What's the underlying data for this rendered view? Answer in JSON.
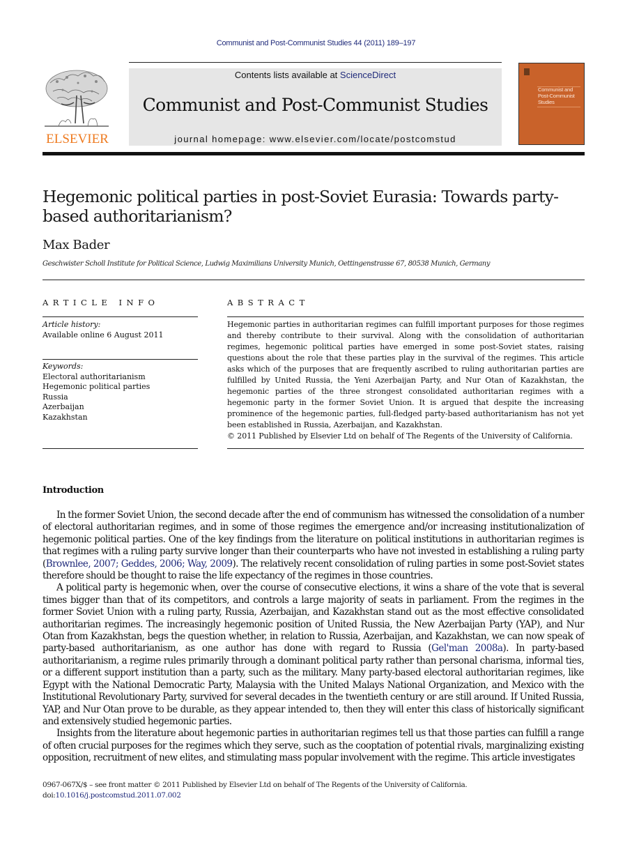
{
  "header": {
    "citation": "Communist and Post-Communist Studies 44 (2011) 189–197",
    "contents_prefix": "Contents lists available at ",
    "contents_link": "ScienceDirect",
    "journal_title": "Communist and Post-Communist Studies",
    "homepage_prefix": "journal homepage: ",
    "homepage_url": "www.elsevier.com/locate/postcomstud",
    "publisher_logo": "ELSEVIER",
    "cover_title": "Communist and Post-Communist Studies",
    "colors": {
      "elsevier_orange": "#ee7a1f",
      "cover_orange": "#c9622a",
      "banner_gray": "#e6e6e6",
      "link_blue": "#1f2a7a"
    }
  },
  "article": {
    "title": "Hegemonic political parties in post-Soviet Eurasia: Towards party-based authoritarianism?",
    "author": "Max Bader",
    "affiliation": "Geschwister Scholl Institute for Political Science, Ludwig Maximilians University Munich, Oettingenstrasse 67, 80538 Munich, Germany"
  },
  "article_info": {
    "heading": "ARTICLE INFO",
    "history_label": "Article history:",
    "history_value": "Available online 6 August 2011",
    "keywords_label": "Keywords:",
    "keywords": [
      "Electoral authoritarianism",
      "Hegemonic political parties",
      "Russia",
      "Azerbaijan",
      "Kazakhstan"
    ]
  },
  "abstract": {
    "heading": "ABSTRACT",
    "text": "Hegemonic parties in authoritarian regimes can fulfill important purposes for those regimes and thereby contribute to their survival. Along with the consolidation of authoritarian regimes, hegemonic political parties have emerged in some post-Soviet states, raising questions about the role that these parties play in the survival of the regimes. This article asks which of the purposes that are frequently ascribed to ruling authoritarian parties are fulfilled by United Russia, the Yeni Azerbaijan Party, and Nur Otan of Kazakhstan, the hegemonic parties of the three strongest consolidated authoritarian regimes with a hegemonic party in the former Soviet Union. It is argued that despite the increasing prominence of the hegemonic parties, full-fledged party-based authoritari­anism has not yet been established in Russia, Azerbaijan, and Kazakhstan.",
    "copyright": "© 2011 Published by Elsevier Ltd on behalf of The Regents of the University of California."
  },
  "introduction": {
    "heading": "Introduction",
    "p1_a": "In the former Soviet Union, the second decade after the end of communism has witnessed the consolidation of a number of electoral authoritarian regimes, and in some of those regimes the emergence and/or increasing institutionalization of hegemonic political parties. One of the key findings from the literature on political institutions in authoritarian regimes is that regimes with a ruling party survive longer than their counterparts who have not invested in establishing a ruling party (",
    "p1_cite": "Brownlee, 2007; Geddes, 2006; Way, 2009",
    "p1_b": "). The relatively recent consolidation of ruling parties in some post-Soviet states therefore should be thought to raise the life expectancy of the regimes in those countries.",
    "p2_a": "A political party is hegemonic when, over the course of consecutive elections, it wins a share of the vote that is several times bigger than that of its competitors, and controls a large majority of seats in parliament. From the regimes in the former Soviet Union with a ruling party, Russia, Azerbaijan, and Kazakhstan stand out as the most effective consolidated authori­tarian regimes. The increasingly hegemonic position of United Russia, the New Azerbaijan Party (YAP), and Nur Otan from Kazakhstan, begs the question whether, in relation to Russia, Azerbaijan, and Kazakhstan, we can now speak of party-based authoritarianism, as one author has done with regard to Russia (",
    "p2_cite": "Gel'man 2008a",
    "p2_b": "). In party-based authoritarianism, a regime rules primarily through a dominant political party rather than personal charisma, informal ties, or a different support institution than a party, such as the military. Many party-based electoral authoritarian regimes, like Egypt with the National Democratic Party, Malaysia with the United Malays National Organization, and Mexico with the Institutional Revolutionary Party, survived for several decades in the twentieth century or are still around. If United Russia, YAP, and Nur Otan prove to be durable, as they appear intended to, then they will enter this class of historically significant and extensively studied hege­monic parties.",
    "p3": "Insights from the literature about hegemonic parties in authoritarian regimes tell us that those parties can fulfill a range of often crucial purposes for the regimes which they serve, such as the cooptation of potential rivals, marginalizing existing opposition, recruitment of new elites, and stimulating mass popular involvement with the regime. This article investigates"
  },
  "footer": {
    "issn_line": "0967-067X/$ – see front matter © 2011 Published by Elsevier Ltd on behalf of The Regents of the University of California.",
    "doi_prefix": "doi:",
    "doi": "10.1016/j.postcomstud.2011.07.002"
  }
}
